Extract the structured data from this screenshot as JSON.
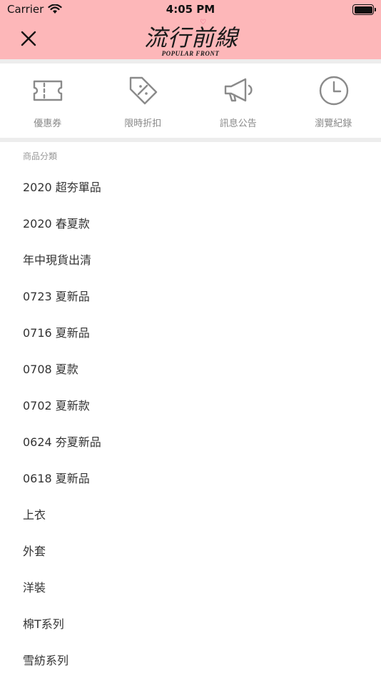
{
  "status_bar": {
    "carrier": "Carrier",
    "time": "4:05 PM"
  },
  "header": {
    "close_icon": "close-icon",
    "logo_text": "流行前線",
    "logo_subtext": "POPULAR FRONT",
    "background_color": "#fdb7b9"
  },
  "quick_menu": [
    {
      "label": "優惠券",
      "icon": "ticket-icon"
    },
    {
      "label": "限時折扣",
      "icon": "discount-tag-icon"
    },
    {
      "label": "訊息公告",
      "icon": "megaphone-icon"
    },
    {
      "label": "瀏覽紀錄",
      "icon": "clock-icon"
    }
  ],
  "categories": {
    "title": "商品分類",
    "items": [
      "2020 超夯單品",
      "2020 春夏款",
      "年中現貨出清",
      "0723 夏新品",
      "0716 夏新品",
      "0708 夏款",
      "0702 夏新款",
      "0624 夯夏新品",
      "0618 夏新品",
      "上衣",
      "外套",
      "洋裝",
      "棉T系列",
      "雪紡系列"
    ]
  }
}
